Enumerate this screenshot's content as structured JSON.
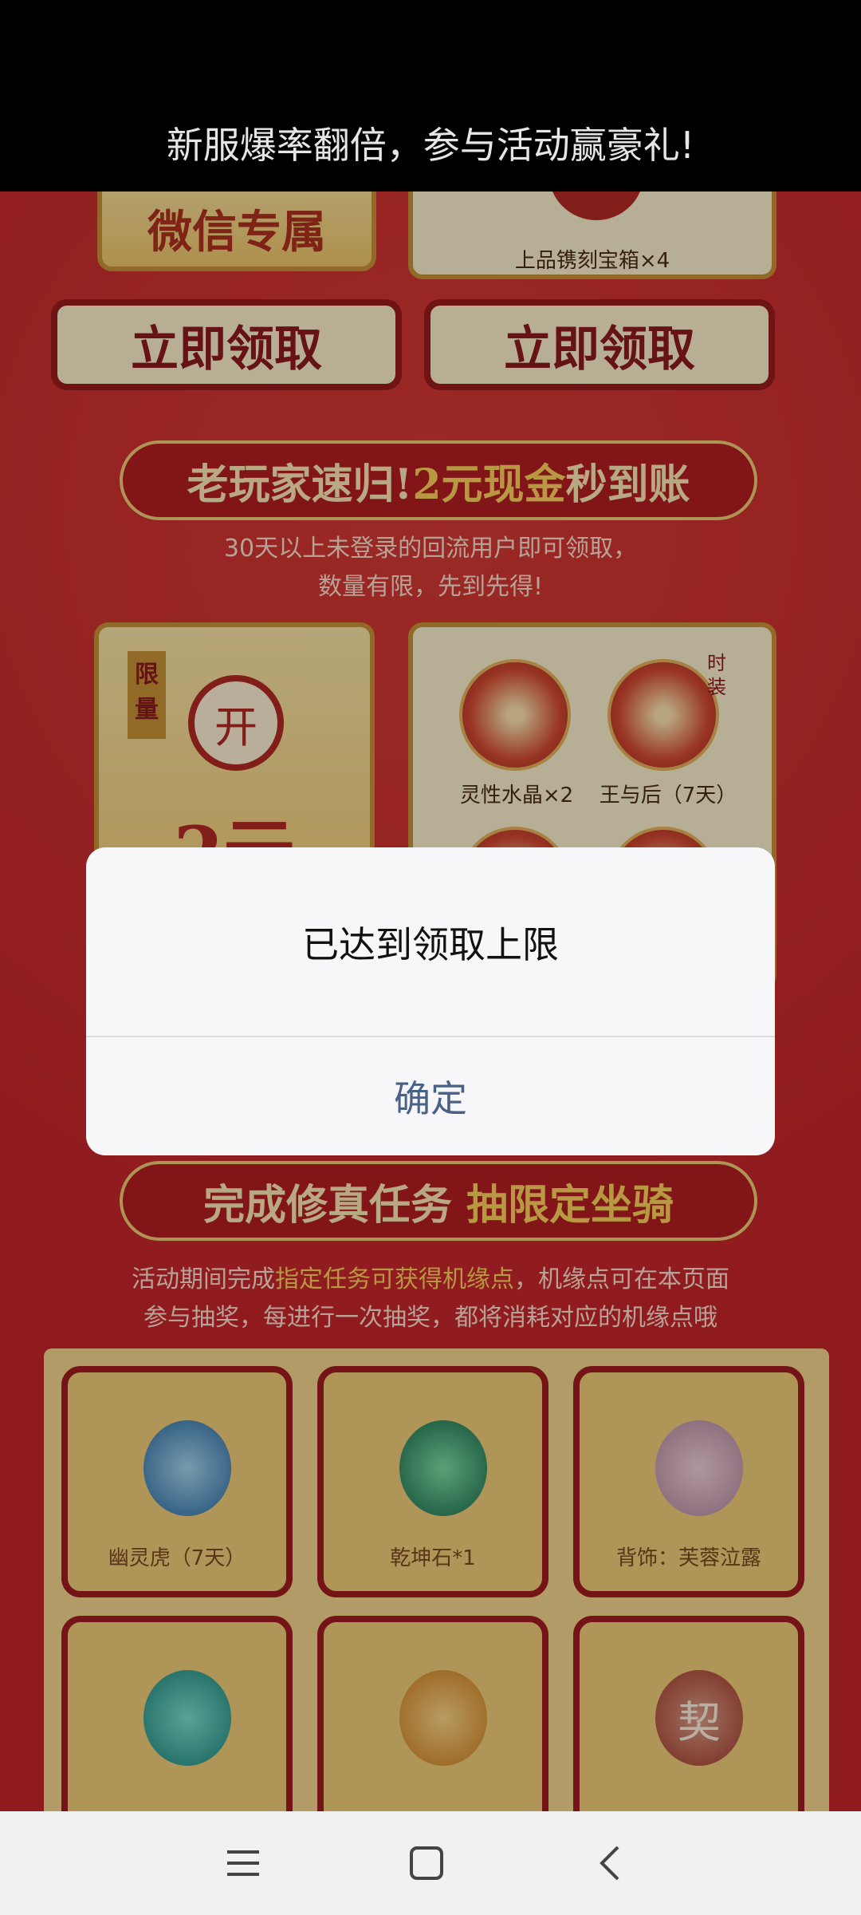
{
  "header": {
    "title": "新服爆率翻倍，参与活动赢豪礼!"
  },
  "top_section": {
    "wechat_card_title": "微信专属",
    "gift_label": "上品镌刻宝箱×4",
    "claim_button_left": "立即领取",
    "claim_button_right": "立即领取"
  },
  "returning_section": {
    "banner_part1": "老玩家速归!",
    "banner_highlight": "2元现金",
    "banner_part2": "秒到账",
    "desc_line1": "30天以上未登录的回流用户即可领取，",
    "desc_line2": "数量有限，先到先得!",
    "envelope_badge": "限量",
    "envelope_open": "开",
    "envelope_amount": "2元",
    "reward1_label": "灵性水晶×2",
    "reward2_label": "王与后（7天）",
    "reward2_badge": "时装"
  },
  "quest_section": {
    "banner_part1": "完成修真任务",
    "banner_highlight": "抽限定坐骑",
    "desc_part1": "活动期间完成",
    "desc_highlight": "指定任务可获得机缘点",
    "desc_part2": "，机缘点可在本页面",
    "desc_line2": "参与抽奖，每进行一次抽奖，都将消耗对应的机缘点哦",
    "items": [
      {
        "label": "幽灵虎（7天）",
        "icon": "tiger-icon"
      },
      {
        "label": "乾坤石*1",
        "icon": "green-stone-icon"
      },
      {
        "label": "背饰：芙蓉泣露",
        "icon": "flower-icon"
      },
      {
        "label": "",
        "icon": "gourd-icon"
      },
      {
        "label": "",
        "icon": "crystal-icon"
      },
      {
        "label": "契",
        "icon": "contract-icon"
      }
    ]
  },
  "dialog": {
    "message": "已达到领取上限",
    "confirm_label": "确定"
  },
  "colors": {
    "page_red": "#c8262b",
    "gold": "#ffd35c",
    "dialog_button_text": "#4a6187"
  }
}
